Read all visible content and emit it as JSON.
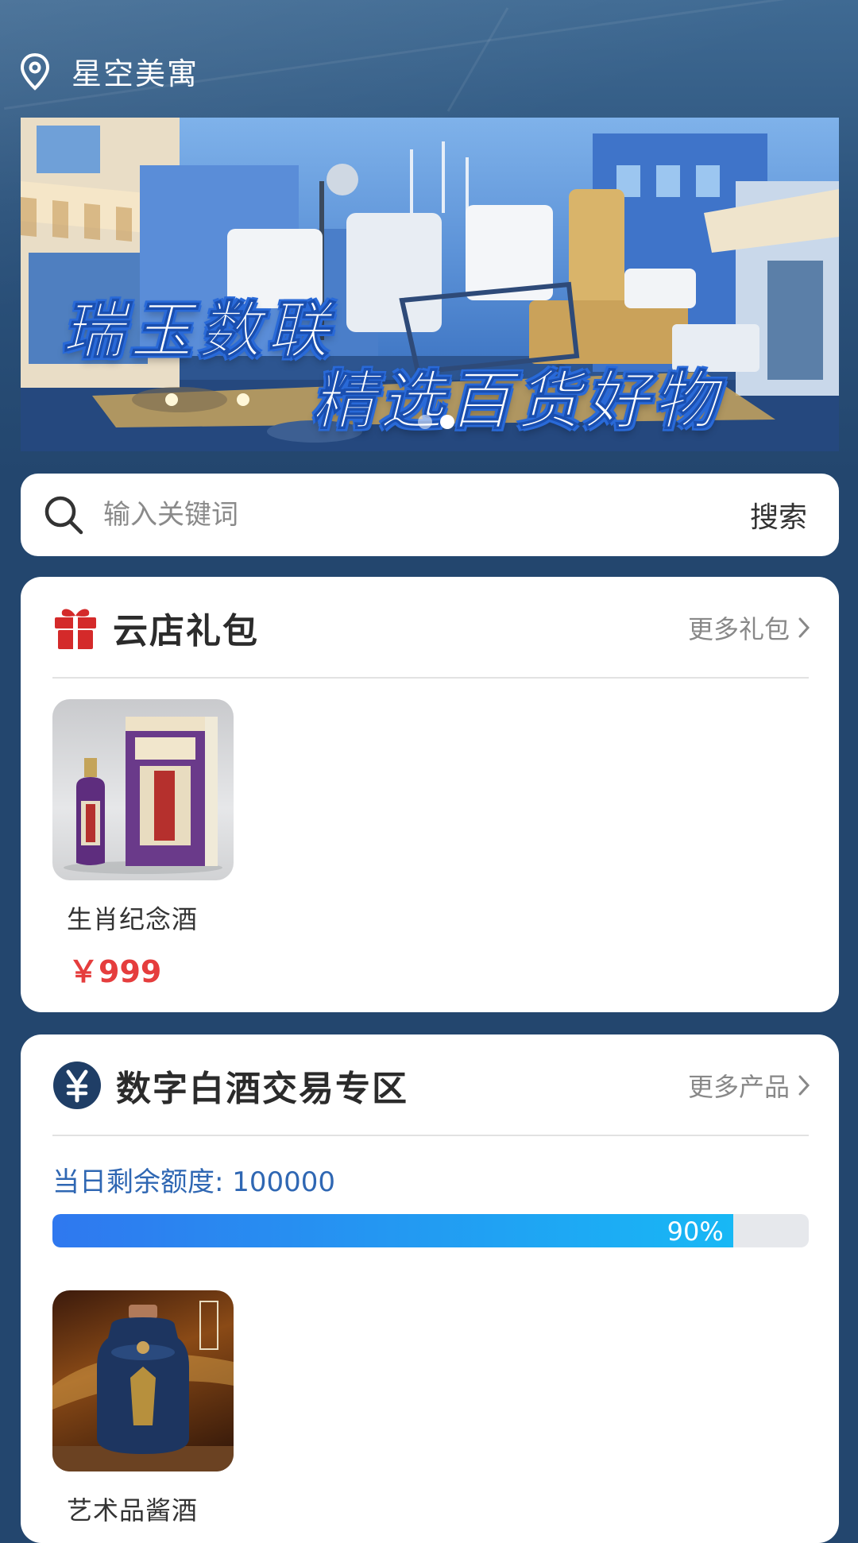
{
  "header": {
    "location": "星空美寓"
  },
  "banner": {
    "title_line1": "瑞玉数联",
    "title_line2": "精选百货好物",
    "slides": 2,
    "active_slide": 2
  },
  "search": {
    "placeholder": "输入关键词",
    "button_label": "搜索"
  },
  "gift_section": {
    "title": "云店礼包",
    "more_label": "更多礼包",
    "products": [
      {
        "name": "生肖纪念酒",
        "price": "￥999"
      }
    ]
  },
  "baijiu_section": {
    "title": "数字白酒交易专区",
    "more_label": "更多产品",
    "quota_label": "当日剩余额度: 100000",
    "progress_text": "90%",
    "progress_value": 0.9,
    "products": [
      {
        "name": "艺术品酱酒"
      }
    ]
  },
  "colors": {
    "background": "#23466e",
    "price_red": "#e53d3d",
    "quota_blue": "#2f67b3",
    "gift_red": "#d42a2a",
    "yen_navy": "#1f3e66"
  }
}
